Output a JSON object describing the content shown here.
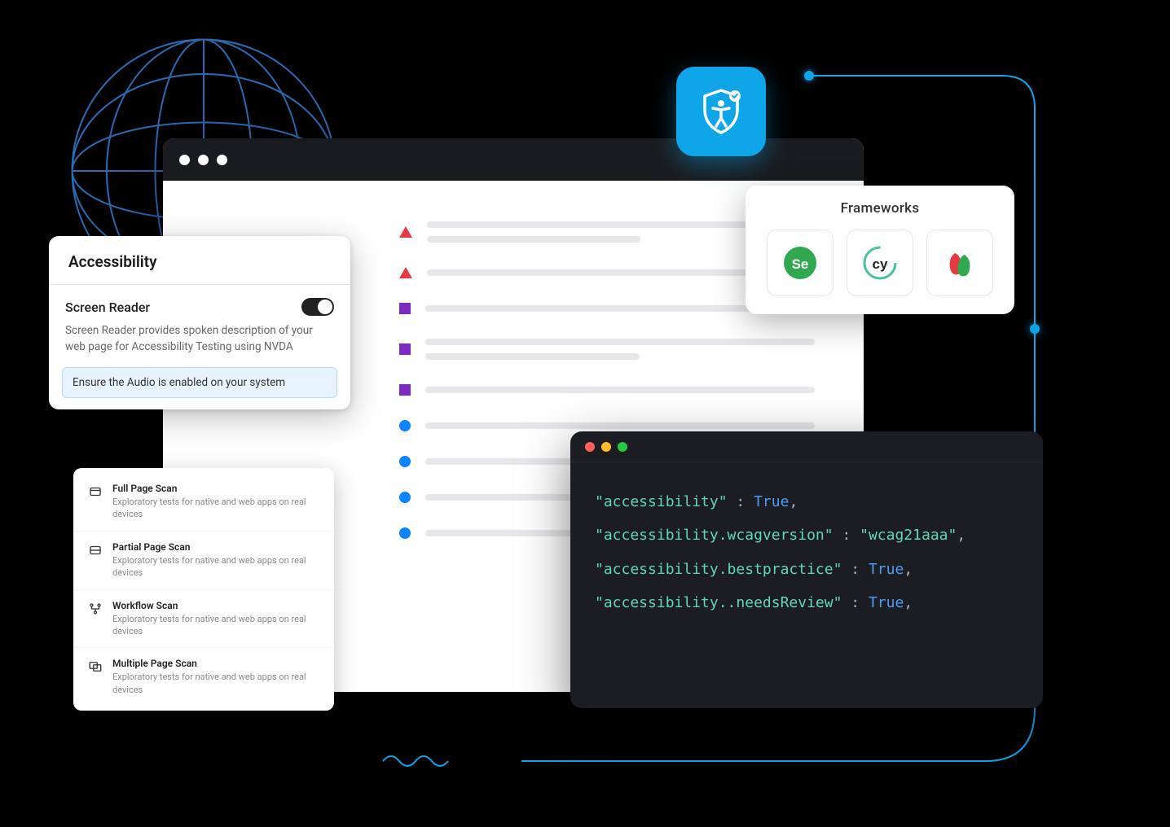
{
  "accessibility_card": {
    "title": "Accessibility",
    "section_title": "Screen Reader",
    "description": "Screen Reader provides spoken description of your web page for Accessibility Testing using NVDA",
    "note": "Ensure the Audio is enabled on your system"
  },
  "scan_list": [
    {
      "title": "Full Page Scan",
      "desc": "Exploratory tests for native and web apps on real devices"
    },
    {
      "title": "Partial Page Scan",
      "desc": "Exploratory tests for native and web apps on real devices"
    },
    {
      "title": "Workflow Scan",
      "desc": "Exploratory tests for native and web apps on real devices"
    },
    {
      "title": "Multiple Page Scan",
      "desc": "Exploratory tests for native and web apps on real devices"
    }
  ],
  "frameworks": {
    "title": "Frameworks",
    "items": [
      "Selenium",
      "Cypress",
      "Playwright"
    ]
  },
  "code": {
    "k1": "\"accessibility\"",
    "v1": "True",
    "k2": "\"accessibility.wcagversion\"",
    "v2": "\"wcag21aaa\"",
    "k3": "\"accessibility.bestpractice\"",
    "v3": "True",
    "k4": "\"accessibility..needsReview\"",
    "v4": "True"
  },
  "punct": {
    "colon": " : ",
    "comma": ","
  }
}
